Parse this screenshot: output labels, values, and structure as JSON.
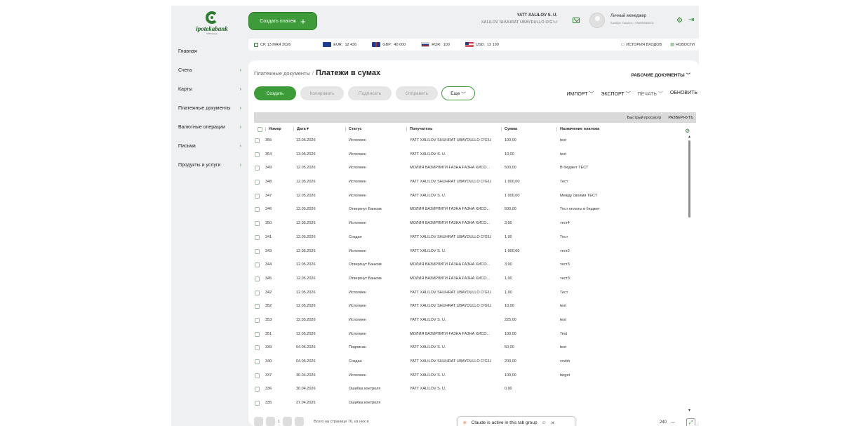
{
  "brand": {
    "logo_text": "ipotekabank",
    "logo_sub": "OTP Group"
  },
  "header": {
    "create_payment_label": "Создать платеж",
    "org_name": "YATT XALILOV S. U.",
    "org_full": "XALILOV SHUHRAT UBAYDULLO O'G'LI",
    "manager_title": "Личный менеджер",
    "manager_info": "Kamiljon Yakubov • 998998884001"
  },
  "infobar": {
    "date": "СР, 13 МАЯ 2026",
    "rates": [
      {
        "code": "EUR:",
        "value": "12 436"
      },
      {
        "code": "GBP:",
        "value": "40 000"
      },
      {
        "code": "RUR:",
        "value": "100"
      },
      {
        "code": "USD:",
        "value": "12 190"
      }
    ],
    "history": "ИСТОРИЯ ВХОДОВ",
    "news": "НОВОСТИ"
  },
  "sidebar": {
    "items": [
      {
        "label": "Главная"
      },
      {
        "label": "Счета"
      },
      {
        "label": "Карты"
      },
      {
        "label": "Платежные документы"
      },
      {
        "label": "Валютные операции"
      },
      {
        "label": "Письма"
      },
      {
        "label": "Продукты и услуги"
      }
    ]
  },
  "main": {
    "breadcrumb_parent": "Платежные документы",
    "breadcrumb_sep": "/",
    "title": "Платежи в сумах",
    "work_docs": "РАБОЧИЕ ДОКУМЕНТЫ",
    "buttons": {
      "create": "Создать",
      "copy": "Копировать",
      "sign": "Подписать",
      "send": "Отправить",
      "more": "Еще"
    },
    "actions": {
      "import": "ИМПОРТ",
      "export": "ЭКСПОРТ",
      "print": "ПЕЧАТЬ",
      "refresh": "ОБНОВИТЬ"
    },
    "quick_view": "Быстрый просмотр",
    "expand": "РАЗВЕРНУТЬ"
  },
  "table": {
    "headers": [
      "Номер",
      "Дата",
      "Статус",
      "Получатель",
      "Сумма",
      "Назначение платежа"
    ],
    "rows": [
      [
        "355",
        "13.05.2026",
        "Исполнен",
        "YATT XALILOV SHUHRAT UBAYDULLO O'G'LI",
        "100,00",
        "test"
      ],
      [
        "354",
        "13.05.2026",
        "Исполнен",
        "YATT XALILOV S. U.",
        "10,00",
        "test"
      ],
      [
        "349",
        "12.05.2026",
        "Исполнен",
        "МОЛИЯ ВАЗИРЛИГИ ҒАЗНА ҒАЗНА ХИСО...",
        "500,00",
        "В бюджет ТЕСТ"
      ],
      [
        "348",
        "12.05.2026",
        "Исполнен",
        "YATT XALILOV SHUHRAT UBAYDULLO O'G'LI",
        "1 000,00",
        "Тест"
      ],
      [
        "347",
        "12.05.2026",
        "Исполнен",
        "YATT XALILOV S. U.",
        "1 000,00",
        "Между своими ТЕСТ"
      ],
      [
        "346",
        "12.05.2026",
        "Отвергнут Банком",
        "МОЛИЯ ВАЗИРЛИГИ ҒАЗНА ҒАЗНА ХИСО...",
        "500,00",
        "Тест оплаты в бюджет"
      ],
      [
        "350",
        "12.05.2026",
        "Исполнен",
        "МОЛИЯ ВАЗИРЛИГИ ҒАЗНА ҒАЗНА ХИСО...",
        "3,00",
        "тест4"
      ],
      [
        "341",
        "12.05.2026",
        "Создан",
        "YATT XALILOV SHUHRAT UBAYDULLO O'G'LI",
        "1,00",
        "Тест"
      ],
      [
        "343",
        "12.05.2026",
        "Исполнен",
        "YATT XALILOV S. U.",
        "1 000,00",
        "тест2"
      ],
      [
        "344",
        "12.05.2026",
        "Отвергнут Банком",
        "МОЛИЯ ВАЗИРЛИГИ ҒАЗНА ҒАЗНА ХИСО...",
        "3,00",
        "тест3"
      ],
      [
        "345",
        "12.05.2026",
        "Отвергнут Банком",
        "МОЛИЯ ВАЗИРЛИГИ ҒАЗНА ҒАЗНА ХИСО...",
        "1,00",
        "тест3"
      ],
      [
        "342",
        "12.05.2026",
        "Исполнен",
        "YATT XALILOV SHUHRAT UBAYDULLO O'G'LI",
        "1,00",
        "Тест"
      ],
      [
        "352",
        "12.05.2026",
        "Исполнен",
        "YATT XALILOV SHUHRAT UBAYDULLO O'G'LI",
        "10,00",
        "test"
      ],
      [
        "353",
        "12.05.2026",
        "Исполнен",
        "YATT XALILOV S. U.",
        "225,00",
        "test"
      ],
      [
        "351",
        "12.05.2026",
        "Исполнен",
        "МОЛИЯ ВАЗИРЛИГИ ҒАЗНА ҒАЗНА ХИСО...",
        "100,00",
        "Test"
      ],
      [
        "339",
        "04.05.2026",
        "Подписан",
        "YATT XALILOV S. U.",
        "50,00",
        "test"
      ],
      [
        "340",
        "04.05.2026",
        "Создан",
        "YATT XALILOV SHUHRAT UBAYDULLO O'G'LI",
        "200,00",
        "vvvbh"
      ],
      [
        "337",
        "30.04.2026",
        "Исполнен",
        "YATT XALILOV S. U.",
        "100,00",
        "target"
      ],
      [
        "336",
        "30.04.2026",
        "Ошибка контроля",
        "YATT XALILOV S. U.",
        "0,00",
        ""
      ],
      [
        "335",
        "27.04.2026",
        "Ошибка контроля",
        "",
        "",
        ""
      ]
    ]
  },
  "pager": {
    "page": "1",
    "total_text": "Всего на странице 70, из них в",
    "per_page": "240"
  },
  "claude_bar": {
    "text": "Claude is active in this tab group"
  },
  "colors": {
    "accent": "#3e9b3a",
    "background": "#eef0f2"
  },
  "icons": [
    "calendar-icon",
    "mail-icon",
    "settings-icon",
    "logout-icon",
    "column-settings-icon",
    "expand-icon"
  ]
}
